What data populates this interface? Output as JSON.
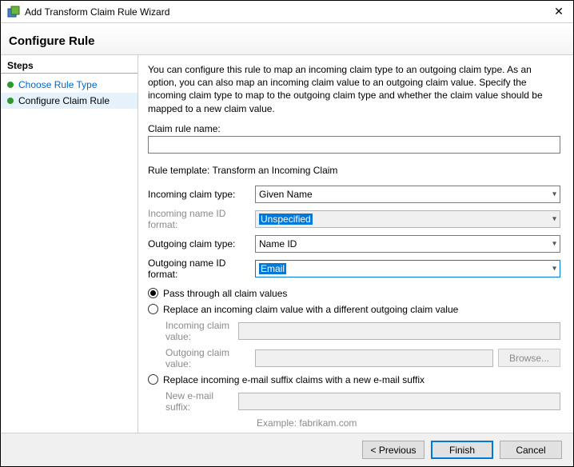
{
  "window": {
    "title": "Add Transform Claim Rule Wizard"
  },
  "header": "Configure Rule",
  "sidebar": {
    "steps_label": "Steps",
    "items": [
      {
        "label": "Choose Rule Type"
      },
      {
        "label": "Configure Claim Rule"
      }
    ]
  },
  "content": {
    "description": "You can configure this rule to map an incoming claim type to an outgoing claim type. As an option, you can also map an incoming claim value to an outgoing claim value. Specify the incoming claim type to map to the outgoing claim type and whether the claim value should be mapped to a new claim value.",
    "claim_rule_name_label": "Claim rule name:",
    "claim_rule_name_value": "",
    "rule_template_label": "Rule template: Transform an Incoming Claim",
    "incoming_claim_type_label": "Incoming claim type:",
    "incoming_claim_type_value": "Given Name",
    "incoming_name_id_format_label": "Incoming name ID format:",
    "incoming_name_id_format_value": "Unspecified",
    "outgoing_claim_type_label": "Outgoing claim type:",
    "outgoing_claim_type_value": "Name ID",
    "outgoing_name_id_format_label": "Outgoing name ID format:",
    "outgoing_name_id_format_value": "Email",
    "radios": {
      "pass_through": "Pass through all claim values",
      "replace_value": "Replace an incoming claim value with a different outgoing claim value",
      "replace_suffix": "Replace incoming e-mail suffix claims with a new e-mail suffix"
    },
    "sub_value": {
      "incoming_label": "Incoming claim value:",
      "outgoing_label": "Outgoing claim value:",
      "browse": "Browse..."
    },
    "sub_suffix": {
      "label": "New e-mail suffix:",
      "hint": "Example: fabrikam.com"
    }
  },
  "footer": {
    "previous": "< Previous",
    "finish": "Finish",
    "cancel": "Cancel"
  }
}
